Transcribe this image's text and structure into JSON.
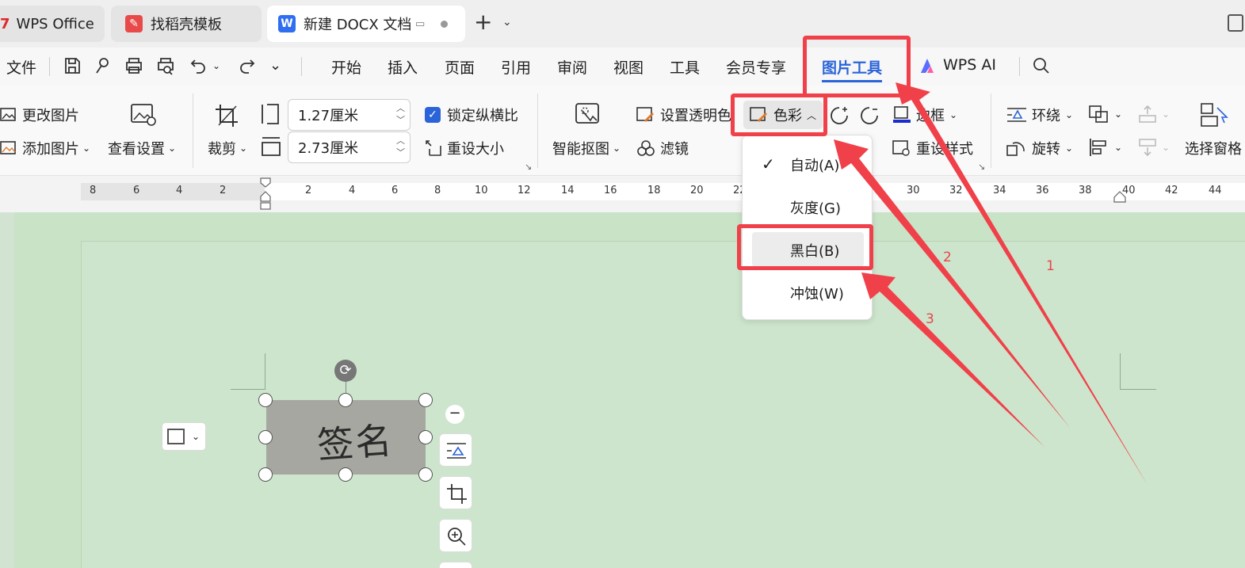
{
  "tabs": [
    {
      "label": "WPS Office",
      "icon": "wps-logo-icon"
    },
    {
      "label": "找稻壳模板",
      "icon": "docer-icon"
    },
    {
      "label": "新建 DOCX 文档",
      "icon": "writer-icon",
      "badge": "W"
    }
  ],
  "menu": {
    "file": "文件",
    "items": [
      "开始",
      "插入",
      "页面",
      "引用",
      "审阅",
      "视图",
      "工具",
      "会员专享"
    ],
    "active": "图片工具",
    "ai": "WPS AI"
  },
  "ribbon": {
    "change_picture": "更改图片",
    "add_picture": "添加图片",
    "view_settings": "查看设置",
    "crop": "裁剪",
    "height_value": "1.27厘米",
    "width_value": "2.73厘米",
    "lock_ratio": "锁定纵横比",
    "reset_size": "重设大小",
    "smart_cutout": "智能抠图",
    "set_transparent": "设置透明色",
    "filter": "滤镜",
    "color": "色彩",
    "border": "边框",
    "reset_style": "重设样式",
    "wrap": "环绕",
    "rotate": "旋转",
    "selection_pane": "选择窗格"
  },
  "ruler": {
    "labels": [
      "8",
      "6",
      "4",
      "2",
      "2",
      "4",
      "6",
      "8",
      "10",
      "12",
      "14",
      "16",
      "18",
      "20",
      "22",
      "30",
      "32",
      "34",
      "36",
      "38",
      "40",
      "42",
      "44"
    ]
  },
  "color_menu": {
    "items": [
      "自动(A)",
      "灰度(G)",
      "黑白(B)",
      "冲蚀(W)"
    ],
    "checked": "自动(A)",
    "hovered": "黑白(B)"
  },
  "image": {
    "text": "签名"
  },
  "annotations": [
    "1",
    "2",
    "3"
  ],
  "colors": {
    "accent": "#2b64d9",
    "highlight": "#f0404a",
    "canvas": "#c9e3c7"
  }
}
